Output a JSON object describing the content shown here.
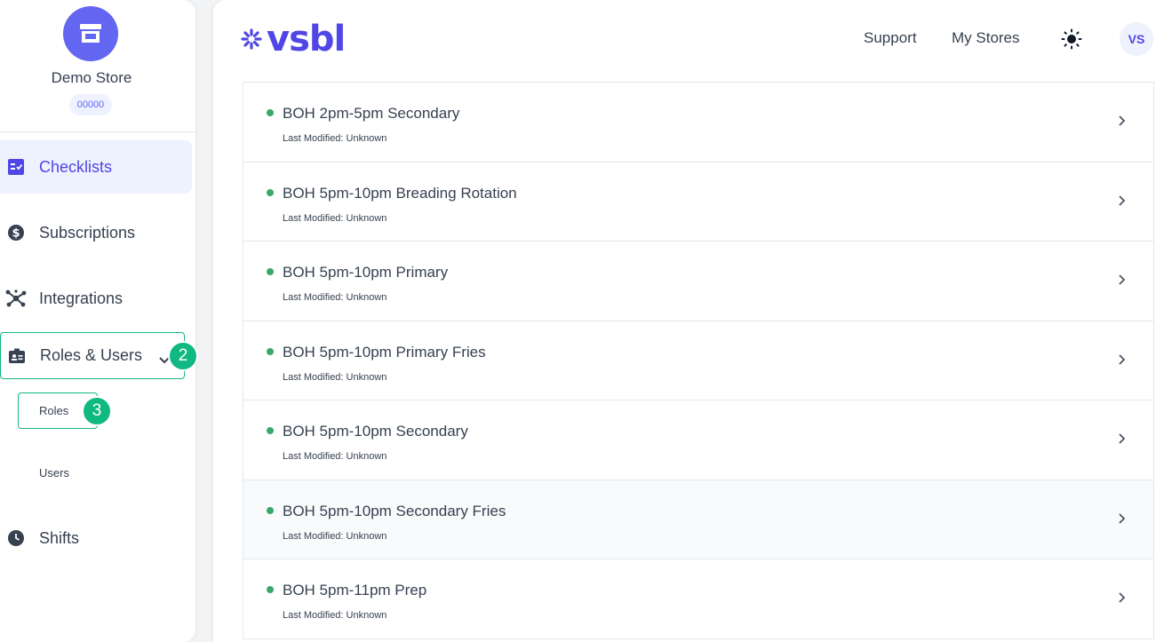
{
  "colors": {
    "accent": "#4f46e5",
    "avatar_bg": "#6366f1",
    "highlight_green": "#10b981",
    "status_dot": "#3aa76d"
  },
  "sidebar": {
    "store_name": "Demo Store",
    "store_code": "00000",
    "store_icon": "storefront-icon",
    "items": [
      {
        "label": "Checklists",
        "icon": "checklist-icon",
        "active": true
      },
      {
        "label": "Subscriptions",
        "icon": "dollar-icon"
      },
      {
        "label": "Integrations",
        "icon": "hub-icon"
      },
      {
        "label": "Roles & Users",
        "icon": "badge-icon",
        "expanded": true,
        "sub_items": [
          {
            "label": "Roles"
          },
          {
            "label": "Users"
          }
        ]
      },
      {
        "label": "Shifts",
        "icon": "clock-icon"
      }
    ]
  },
  "annotations": [
    {
      "label": "2"
    },
    {
      "label": "3"
    }
  ],
  "header": {
    "logo_text": "vsbl",
    "links": [
      {
        "label": "Support"
      },
      {
        "label": "My Stores"
      }
    ],
    "theme_icon": "sun-icon",
    "user_initials": "VS"
  },
  "list": {
    "items": [
      {
        "title": "BOH 2pm-5pm Secondary",
        "meta": "Last Modified: Unknown",
        "status": "active"
      },
      {
        "title": "BOH 5pm-10pm Breading Rotation",
        "meta": "Last Modified: Unknown",
        "status": "active"
      },
      {
        "title": "BOH 5pm-10pm Primary",
        "meta": "Last Modified: Unknown",
        "status": "active"
      },
      {
        "title": "BOH 5pm-10pm Primary Fries",
        "meta": "Last Modified: Unknown",
        "status": "active"
      },
      {
        "title": "BOH 5pm-10pm Secondary",
        "meta": "Last Modified: Unknown",
        "status": "active"
      },
      {
        "title": "BOH 5pm-10pm Secondary Fries",
        "meta": "Last Modified: Unknown",
        "status": "active"
      },
      {
        "title": "BOH 5pm-11pm Prep",
        "meta": "Last Modified: Unknown",
        "status": "active"
      }
    ]
  }
}
